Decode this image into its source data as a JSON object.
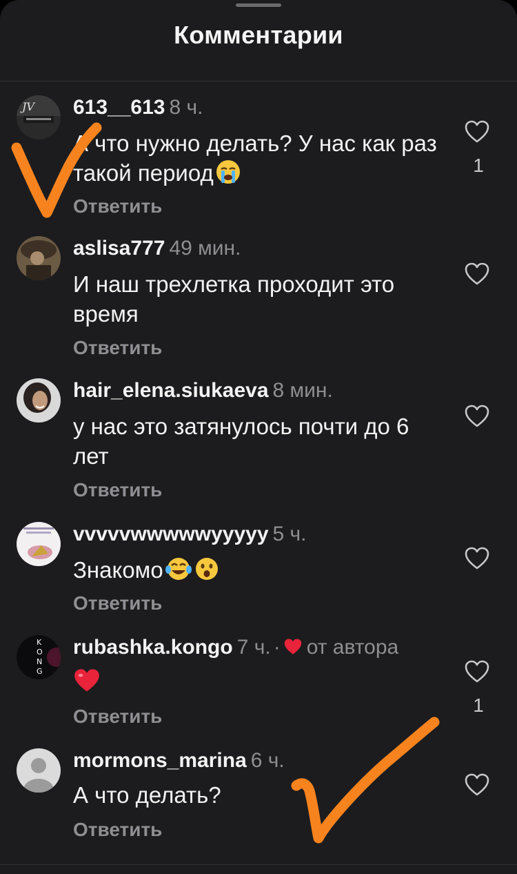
{
  "header": {
    "title": "Комментарии"
  },
  "comments": [
    {
      "username": "613__613",
      "time": "8 ч.",
      "text": "А что нужно делать? У нас как раз такой период",
      "reply": "Ответить",
      "likes": "1",
      "emoji_icons": [
        "loudly-crying-face-icon"
      ]
    },
    {
      "username": "aslisa777",
      "time": "49 мин.",
      "text": "И наш трехлетка проходит это время",
      "reply": "Ответить",
      "likes": ""
    },
    {
      "username": "hair_elena.siukaeva",
      "time": "8 мин.",
      "text": "у нас это затянулось почти до 6 лет",
      "reply": "Ответить",
      "likes": ""
    },
    {
      "username": "vvvvvwwwwwyyyyy",
      "time": "5 ч.",
      "text": "Знакомо",
      "reply": "Ответить",
      "likes": "",
      "emoji_icons": [
        "face-with-tears-of-joy-icon",
        "face-with-open-mouth-icon"
      ]
    },
    {
      "username": "rubashka.kongo",
      "time": "7 ч.",
      "separator": "·",
      "liked_by_author": "от автора",
      "text": "",
      "reply": "Ответить",
      "likes": "1",
      "emoji_icons": [
        "red-heart-icon"
      ]
    },
    {
      "username": "mormons_marina",
      "time": "6 ч.",
      "text": "А что делать?",
      "reply": "Ответить",
      "likes": ""
    }
  ],
  "colors": {
    "background": "#1c1c1e",
    "text": "#f2f2f2",
    "secondary_text": "#8e8e93",
    "annotation_orange": "#f7831e",
    "heart_red": "#e8233a"
  },
  "avatars": {
    "rubashka_kongo": [
      "K",
      "O",
      "N",
      "G"
    ]
  }
}
